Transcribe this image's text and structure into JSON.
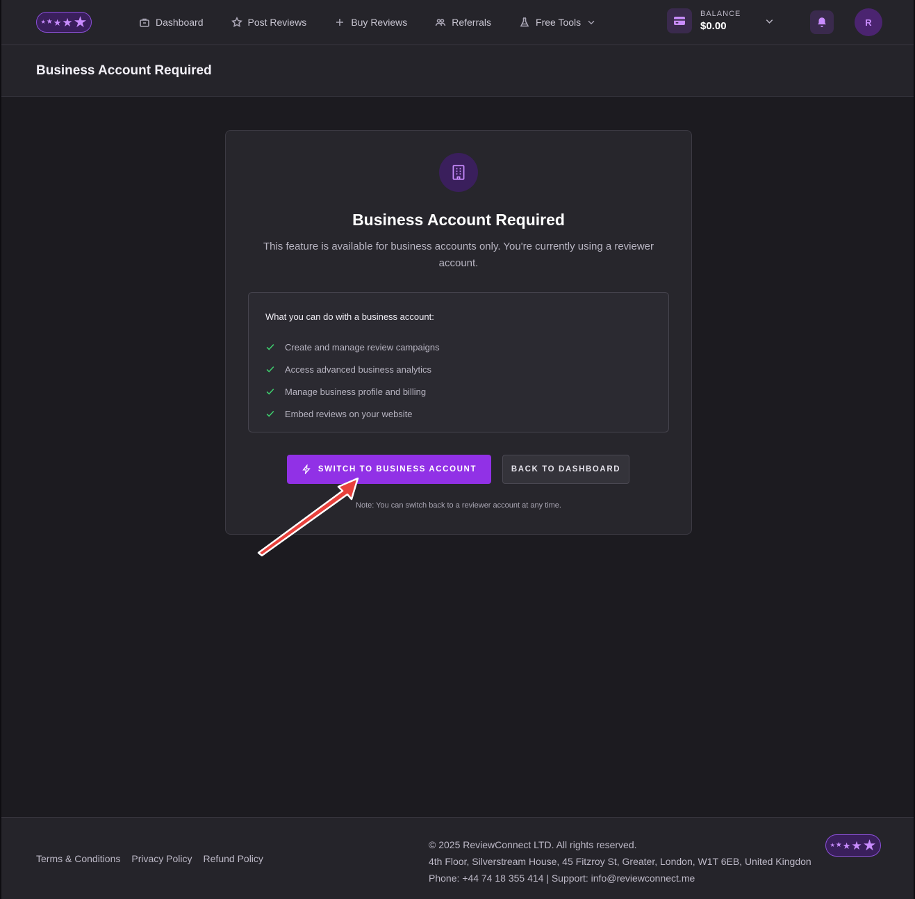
{
  "nav": {
    "items": [
      {
        "label": "Dashboard",
        "icon": "briefcase-icon"
      },
      {
        "label": "Post Reviews",
        "icon": "star-icon"
      },
      {
        "label": "Buy Reviews",
        "icon": "plus-icon"
      },
      {
        "label": "Referrals",
        "icon": "users-icon"
      },
      {
        "label": "Free Tools",
        "icon": "flask-icon"
      }
    ],
    "balance_label": "BALANCE",
    "balance_value": "$0.00",
    "avatar_initial": "R"
  },
  "page": {
    "title": "Business Account Required"
  },
  "card": {
    "title": "Business Account Required",
    "description": "This feature is available for business accounts only. You're currently using a reviewer account.",
    "features_title": "What you can do with a business account:",
    "features": [
      "Create and manage review campaigns",
      "Access advanced business analytics",
      "Manage business profile and billing",
      "Embed reviews on your website"
    ],
    "primary_button": "SWITCH TO BUSINESS ACCOUNT",
    "secondary_button": "BACK TO DASHBOARD",
    "note": "Note: You can switch back to a reviewer account at any time."
  },
  "footer": {
    "links": [
      "Terms & Conditions",
      "Privacy Policy",
      "Refund Policy"
    ],
    "copyright": "© 2025 ReviewConnect LTD. All rights reserved.",
    "address": "4th Floor, Silverstream House, 45 Fitzroy St, Greater, London, W1T 6EB, United Kingdon",
    "contact": "Phone: +44 74 18 355 414 | Support:  info@reviewconnect.me"
  },
  "colors": {
    "accent": "#9131e6",
    "accent_light": "#c98cff",
    "check": "#3ecf6e",
    "annotation_arrow": "#e8413c",
    "background": "#1c1b20",
    "surface": "#25242a"
  }
}
